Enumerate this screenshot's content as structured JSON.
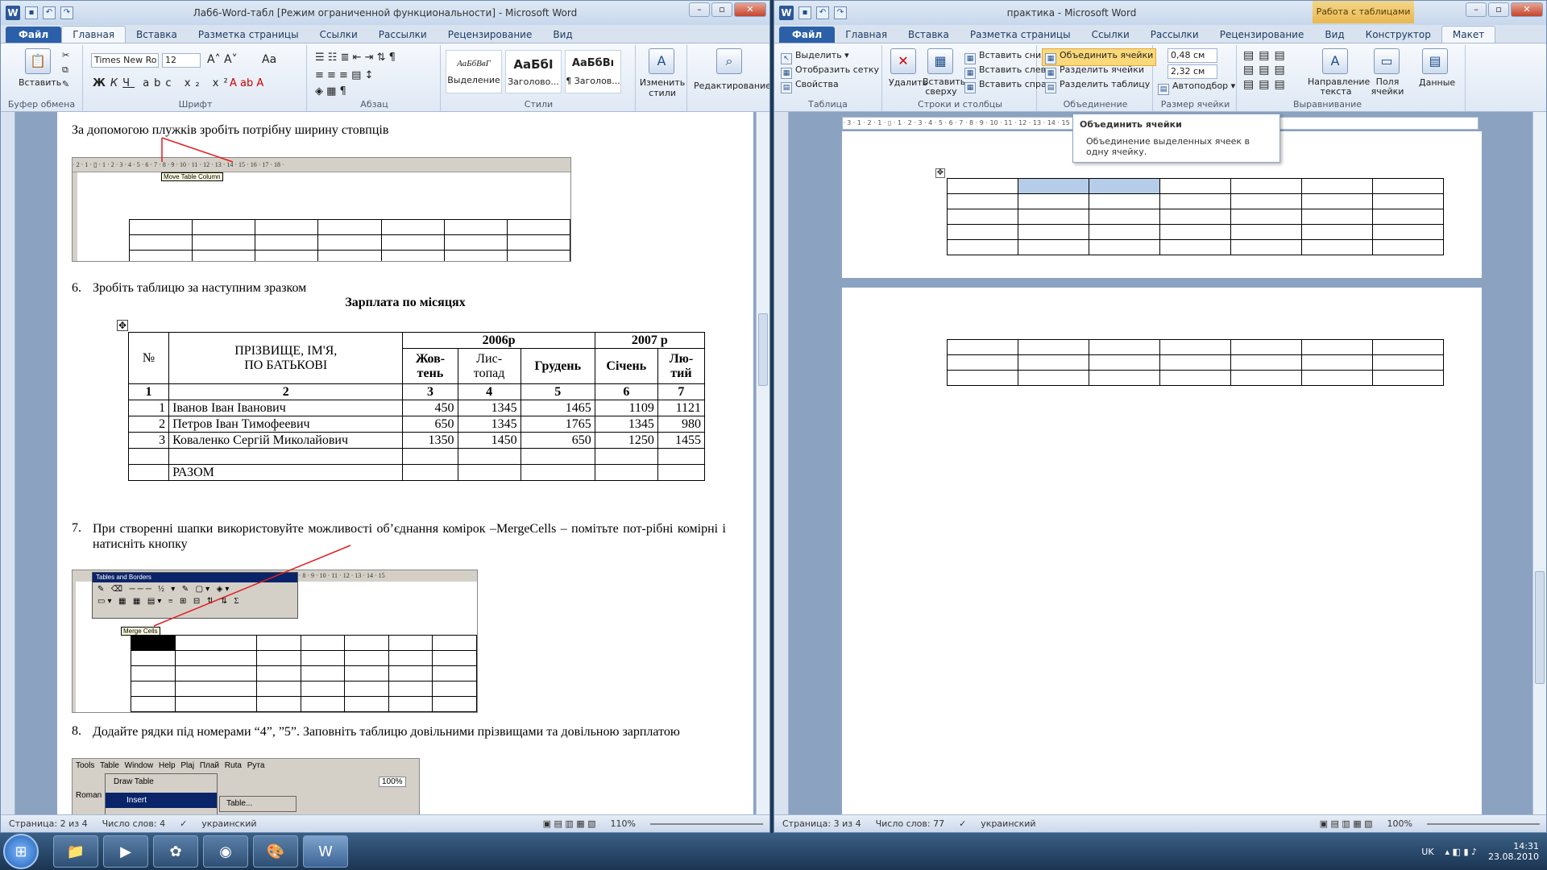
{
  "left_window": {
    "title": "Лаб6-Word-табл [Режим ограниченной функциональности]  -  Microsoft Word",
    "tabs": [
      "Файл",
      "Главная",
      "Вставка",
      "Разметка страницы",
      "Ссылки",
      "Рассылки",
      "Рецензирование",
      "Вид"
    ],
    "active_tab": "Главная",
    "ribbon": {
      "paste": "Вставить",
      "clipboard_group": "Буфер обмена",
      "font_name": "Times New Ro",
      "font_size": "12",
      "font_group": "Шрифт",
      "paragraph_group": "Абзац",
      "styles_group": "Стили",
      "styles": [
        {
          "preview": "АаБбВвГ",
          "name": "Выделение"
        },
        {
          "preview": "АаБбI",
          "name": "Заголово..."
        },
        {
          "preview": "АаБбВı",
          "name": "¶ Заголов..."
        }
      ],
      "change_styles": "Изменить стили",
      "editing": "Редактирование"
    },
    "doc": {
      "line1": "За допомогою плужків зробіть потрібну ширину стовпців",
      "ruler_tooltip": "Move Table Column",
      "item6_num": "6.",
      "item6": "Зробіть таблицю за наступним зразком",
      "table_title": "Зарплата по місяцях",
      "table": {
        "h_no": "№",
        "h_name_1": "ПРІЗВИЩЕ, ІМ'Я,",
        "h_name_2": "ПО БАТЬКОВІ",
        "h_2006": "2006р",
        "h_2007": "2007 р",
        "m1": "Жов-тень",
        "m2": "Лис-топад",
        "m3": "Грудень",
        "m4": "Січень",
        "m5": "Лю-тий",
        "nums": [
          "1",
          "2",
          "3",
          "4",
          "5",
          "6",
          "7"
        ],
        "rows": [
          {
            "n": "1",
            "name": "Іванов Іван Іванович",
            "v": [
              "450",
              "1345",
              "1465",
              "1109",
              "1121"
            ]
          },
          {
            "n": "2",
            "name": "Петров Іван Тимофеевич",
            "v": [
              "650",
              "1345",
              "1765",
              "1345",
              "980"
            ]
          },
          {
            "n": "3",
            "name": "Коваленко Сергій Миколайович",
            "v": [
              "1350",
              "1450",
              "650",
              "1250",
              "1455"
            ]
          }
        ],
        "total": "РАЗОМ"
      },
      "item7_num": "7.",
      "item7": "При створенні шапки використовуйте можливості об’єднання комірок –MergeCells – помітьте пот-рібні комірні і натисніть кнопку",
      "toolbar_title": "Tables and Borders",
      "merge_tooltip": "Merge Cells",
      "item8_num": "8.",
      "item8": "Додайте рядки під номерами “4”, ”5”. Заповніть таблицю довільними прізвищами та довільною зарплатою",
      "menu": [
        "Tools",
        "Table",
        "Window",
        "Help",
        "Plaj",
        "Плай",
        "Ruta",
        "Рута"
      ],
      "menu_items": [
        "Draw Table",
        "Insert",
        "Table..."
      ],
      "zoom_old": "100%",
      "font_old": "Roman"
    },
    "status": {
      "page": "Страница: 2 из 4",
      "words": "Число слов: 4",
      "lang": "украинский",
      "zoom": "110%"
    }
  },
  "right_window": {
    "title": "практика  -  Microsoft Word",
    "context_group": "Работа с таблицами",
    "tabs": [
      "Файл",
      "Главная",
      "Вставка",
      "Разметка страницы",
      "Ссылки",
      "Рассылки",
      "Рецензирование",
      "Вид",
      "Конструктор",
      "Макет"
    ],
    "active_tab": "Макет",
    "ribbon": {
      "select": "Выделить",
      "grid": "Отобразить сетку",
      "props": "Свойства",
      "table_group": "Таблица",
      "delete": "Удалить",
      "insert_above": "Вставить сверху",
      "insert_below": "Вставить снизу",
      "insert_left": "Вставить слева",
      "insert_right": "Вставить справа",
      "rows_group": "Строки и столбцы",
      "merge": "Объединить ячейки",
      "split": "Разделить ячейки",
      "split_table": "Разделить таблицу",
      "merge_group": "Объединение",
      "height": "0,48 см",
      "width": "2,32 см",
      "autofit": "Автоподбор",
      "size_group": "Размер ячейки",
      "direction": "Направление текста",
      "margins": "Поля ячейки",
      "align_group": "Выравнивание",
      "data": "Данные"
    },
    "tooltip": {
      "title": "Объединить ячейки",
      "body": "Объединение выделенных ячеек в одну ячейку."
    },
    "status": {
      "page": "Страница: 3 из 4",
      "words": "Число слов: 77",
      "lang": "украинский",
      "zoom": "100%"
    }
  },
  "taskbar": {
    "lang": "UK",
    "time": "14:31",
    "date": "23.08.2010"
  }
}
